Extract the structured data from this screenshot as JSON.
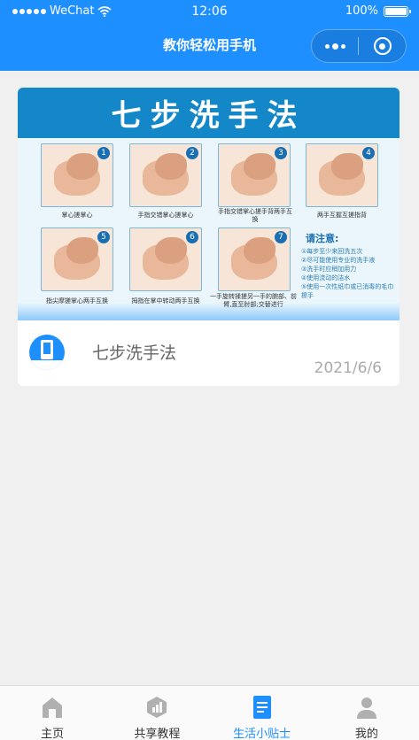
{
  "status_bar": {
    "carrier": "WeChat",
    "time": "12:06",
    "battery": "100%"
  },
  "nav": {
    "title": "教你轻松用手机"
  },
  "article": {
    "banner": {
      "heading": "七步洗手法",
      "steps": [
        {
          "num": "1",
          "caption": "掌心搓掌心"
        },
        {
          "num": "2",
          "caption": "手指交错掌心搓掌心"
        },
        {
          "num": "3",
          "caption": "手指交错掌心搓手背两手互换"
        },
        {
          "num": "4",
          "caption": "两手互握互搓指背"
        },
        {
          "num": "5",
          "caption": "指尖摩搓掌心两手互换"
        },
        {
          "num": "6",
          "caption": "拇指在掌中转动两手互换"
        },
        {
          "num": "7",
          "caption": "一手旋转揉搓另一手的腕部、前臂,直至肘部;交替进行"
        }
      ],
      "notice_title": "请注意:",
      "notice_items": [
        "①每步至少来回洗五次",
        "②尽可能使用专业的洗手液",
        "③洗手时应稍加用力",
        "④使用流动的洁水",
        "⑤使用一次性纸巾或已消毒的毛巾擦手"
      ]
    },
    "title": "七步洗手法",
    "date": "2021/6/6",
    "icon_name": "phone-app-icon"
  },
  "tabbar": {
    "items": [
      {
        "label": "主页",
        "icon": "home-icon",
        "active": false
      },
      {
        "label": "共享教程",
        "icon": "share-tutorial-icon",
        "active": false
      },
      {
        "label": "生活小贴士",
        "icon": "tips-document-icon",
        "active": true
      },
      {
        "label": "我的",
        "icon": "profile-icon",
        "active": false
      }
    ]
  },
  "colors": {
    "brand": "#1e8fff",
    "active_tab": "#1e8fff",
    "inactive_tab_icon": "#b0b0b0",
    "page_bg": "#f0f0f0"
  }
}
